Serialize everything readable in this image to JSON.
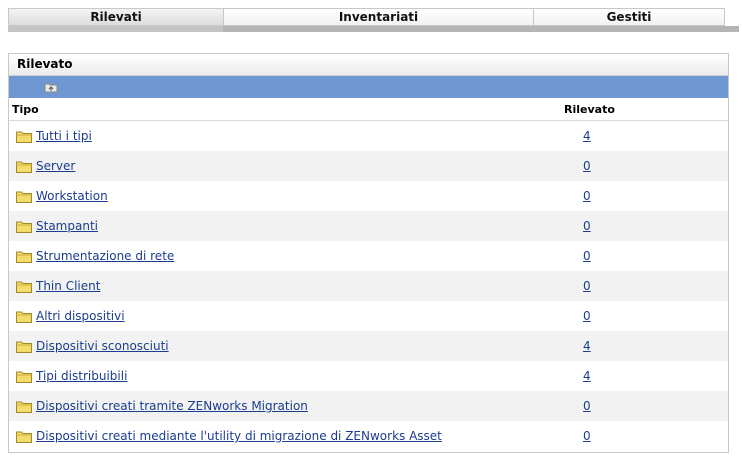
{
  "tabs": [
    {
      "label": "Rilevati",
      "active": true
    },
    {
      "label": "Inventariati",
      "active": false
    },
    {
      "label": "Gestiti",
      "active": false
    }
  ],
  "panel": {
    "title": "Rilevato",
    "toolbar": {
      "up_icon": "folder-up-icon"
    },
    "columns": {
      "type": "Tipo",
      "discovered": "Rilevato"
    },
    "rows": [
      {
        "name": "Tutti i tipi",
        "count": "4"
      },
      {
        "name": "Server",
        "count": "0"
      },
      {
        "name": "Workstation",
        "count": "0"
      },
      {
        "name": "Stampanti",
        "count": "0"
      },
      {
        "name": "Strumentazione di rete",
        "count": "0"
      },
      {
        "name": "Thin Client",
        "count": "0"
      },
      {
        "name": "Altri dispositivi",
        "count": "0"
      },
      {
        "name": "Dispositivi sconosciuti",
        "count": "4"
      },
      {
        "name": "Tipi distribuibili",
        "count": "4"
      },
      {
        "name": "Dispositivi creati tramite ZENworks Migration",
        "count": "0"
      },
      {
        "name": "Dispositivi creati mediante l'utility di migrazione di ZENworks Asset",
        "count": "0"
      }
    ]
  },
  "colors": {
    "toolbar": "#6f97d1",
    "link": "#1a3d8f",
    "folder": "#f3dc6b"
  }
}
